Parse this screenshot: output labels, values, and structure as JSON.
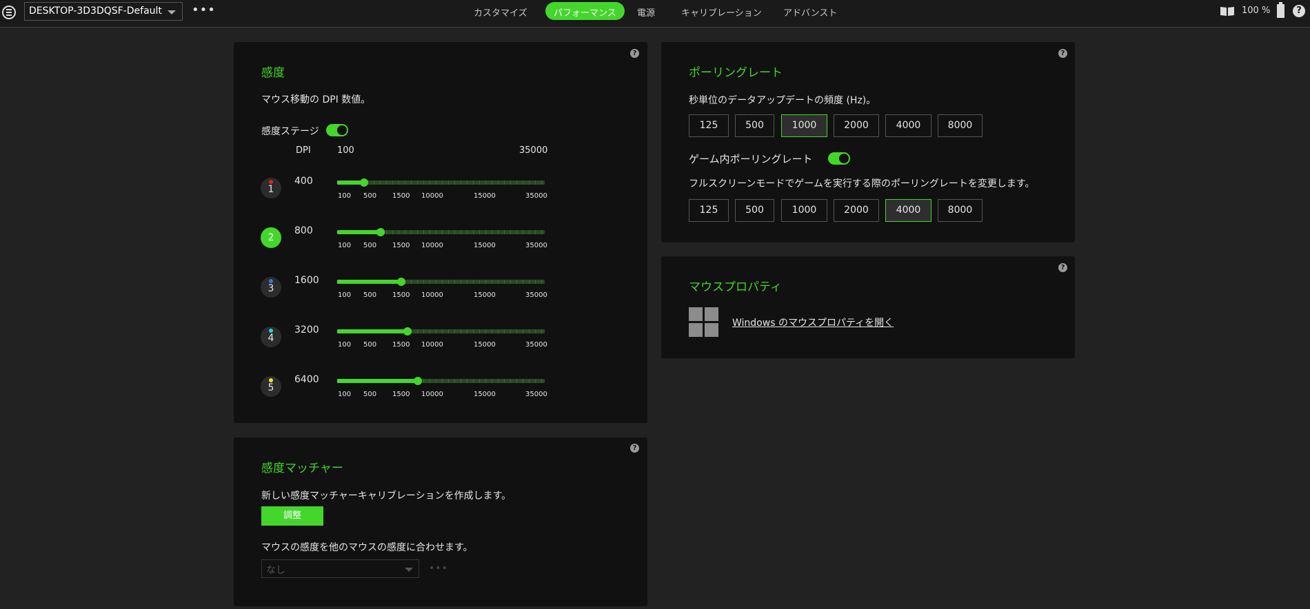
{
  "topbar": {
    "profile": "DESKTOP-3D3DQSF-Default",
    "more": "•••",
    "tabs": [
      {
        "label": "カスタマイズ"
      },
      {
        "label": "パフォーマンス"
      },
      {
        "label": "電源"
      },
      {
        "label": "キャリブレーション"
      },
      {
        "label": "アドバンスト"
      }
    ],
    "active_tab": "パフォーマンス",
    "zoom": "100 %",
    "help": "?"
  },
  "sensitivity": {
    "title": "感度",
    "description": "マウス移動の DPI 数値。",
    "stages_label": "感度ステージ",
    "stages_enabled": true,
    "dpi_header": "DPI",
    "range_min": "100",
    "range_max": "35000",
    "tick_labels": [
      "100",
      "500",
      "1500",
      "10000",
      "15000",
      "35000"
    ],
    "stages": [
      {
        "number": "1",
        "dpi": "400",
        "color": "#e02020",
        "active": false,
        "level": 0.13
      },
      {
        "number": "2",
        "dpi": "800",
        "color": "#44d62c",
        "active": true,
        "level": 0.21
      },
      {
        "number": "3",
        "dpi": "1600",
        "color": "#2a7ae2",
        "active": false,
        "level": 0.31
      },
      {
        "number": "4",
        "dpi": "3200",
        "color": "#22d3e0",
        "active": false,
        "level": 0.34
      },
      {
        "number": "5",
        "dpi": "6400",
        "color": "#e8e040",
        "active": false,
        "level": 0.39
      }
    ]
  },
  "sensitivity_matcher": {
    "title": "感度マッチャー",
    "description": "新しい感度マッチャーキャリブレーションを作成します。",
    "calibrate_button": "調整",
    "match_description": "マウスの感度を他のマウスの感度に合わせます。",
    "mouse_select_value": "なし",
    "more": "•••"
  },
  "polling": {
    "title": "ポーリングレート",
    "description": "秒単位のデータアップデートの頻度 (Hz)。",
    "rates": [
      "125",
      "500",
      "1000",
      "2000",
      "4000",
      "8000"
    ],
    "selected_rate": "1000",
    "ingame_label": "ゲーム内ポーリングレート",
    "ingame_enabled": true,
    "ingame_description": "フルスクリーンモードでゲームを実行する際のポーリングレートを変更します。",
    "ingame_selected_rate": "4000"
  },
  "mouse_properties": {
    "title": "マウスプロパティ",
    "link": "Windows のマウスプロパティを開く"
  },
  "help_glyph": "?",
  "colors": {
    "accent": "#44d62c",
    "background": "#222222",
    "panel": "#111111"
  }
}
